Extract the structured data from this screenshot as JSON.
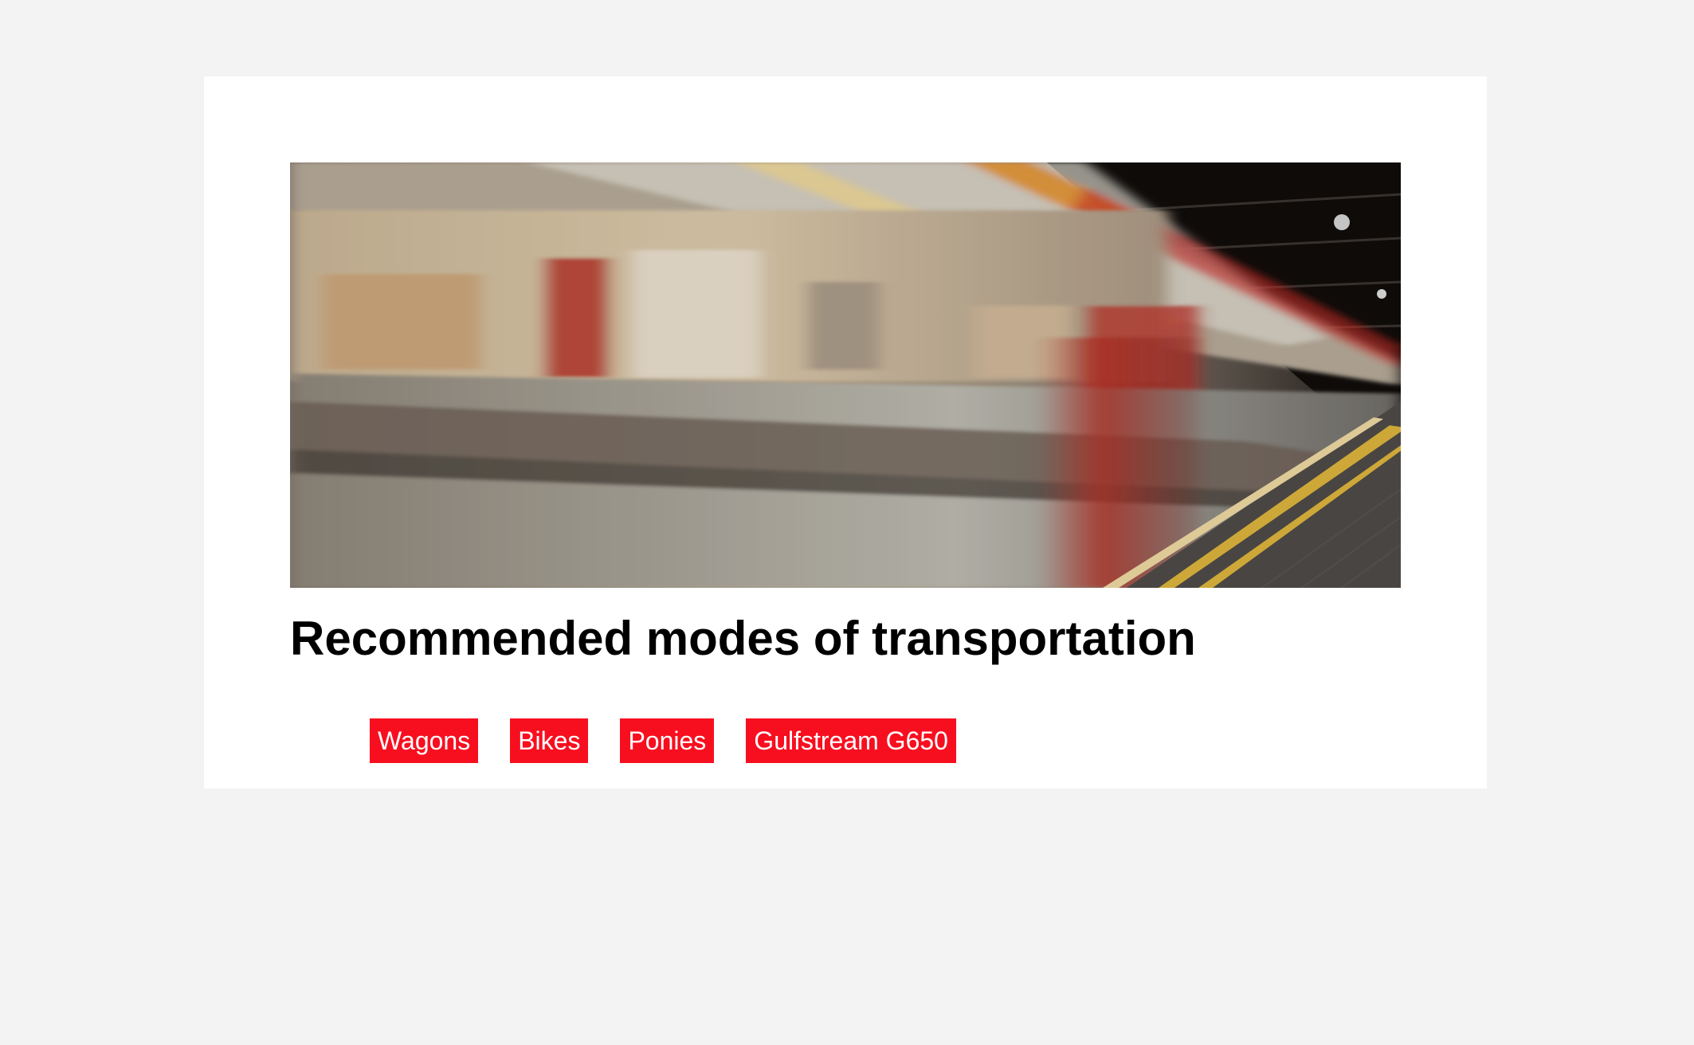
{
  "page": {
    "background_color": "#f3f3f3",
    "card_color": "#ffffff"
  },
  "hero": {
    "image": "blurred-subway-train-photo"
  },
  "content": {
    "title": "Recommended modes of transportation"
  },
  "tags": {
    "color": "#f80f1f",
    "items": [
      "Wagons",
      "Bikes",
      "Ponies",
      "Gulfstream G650"
    ]
  }
}
